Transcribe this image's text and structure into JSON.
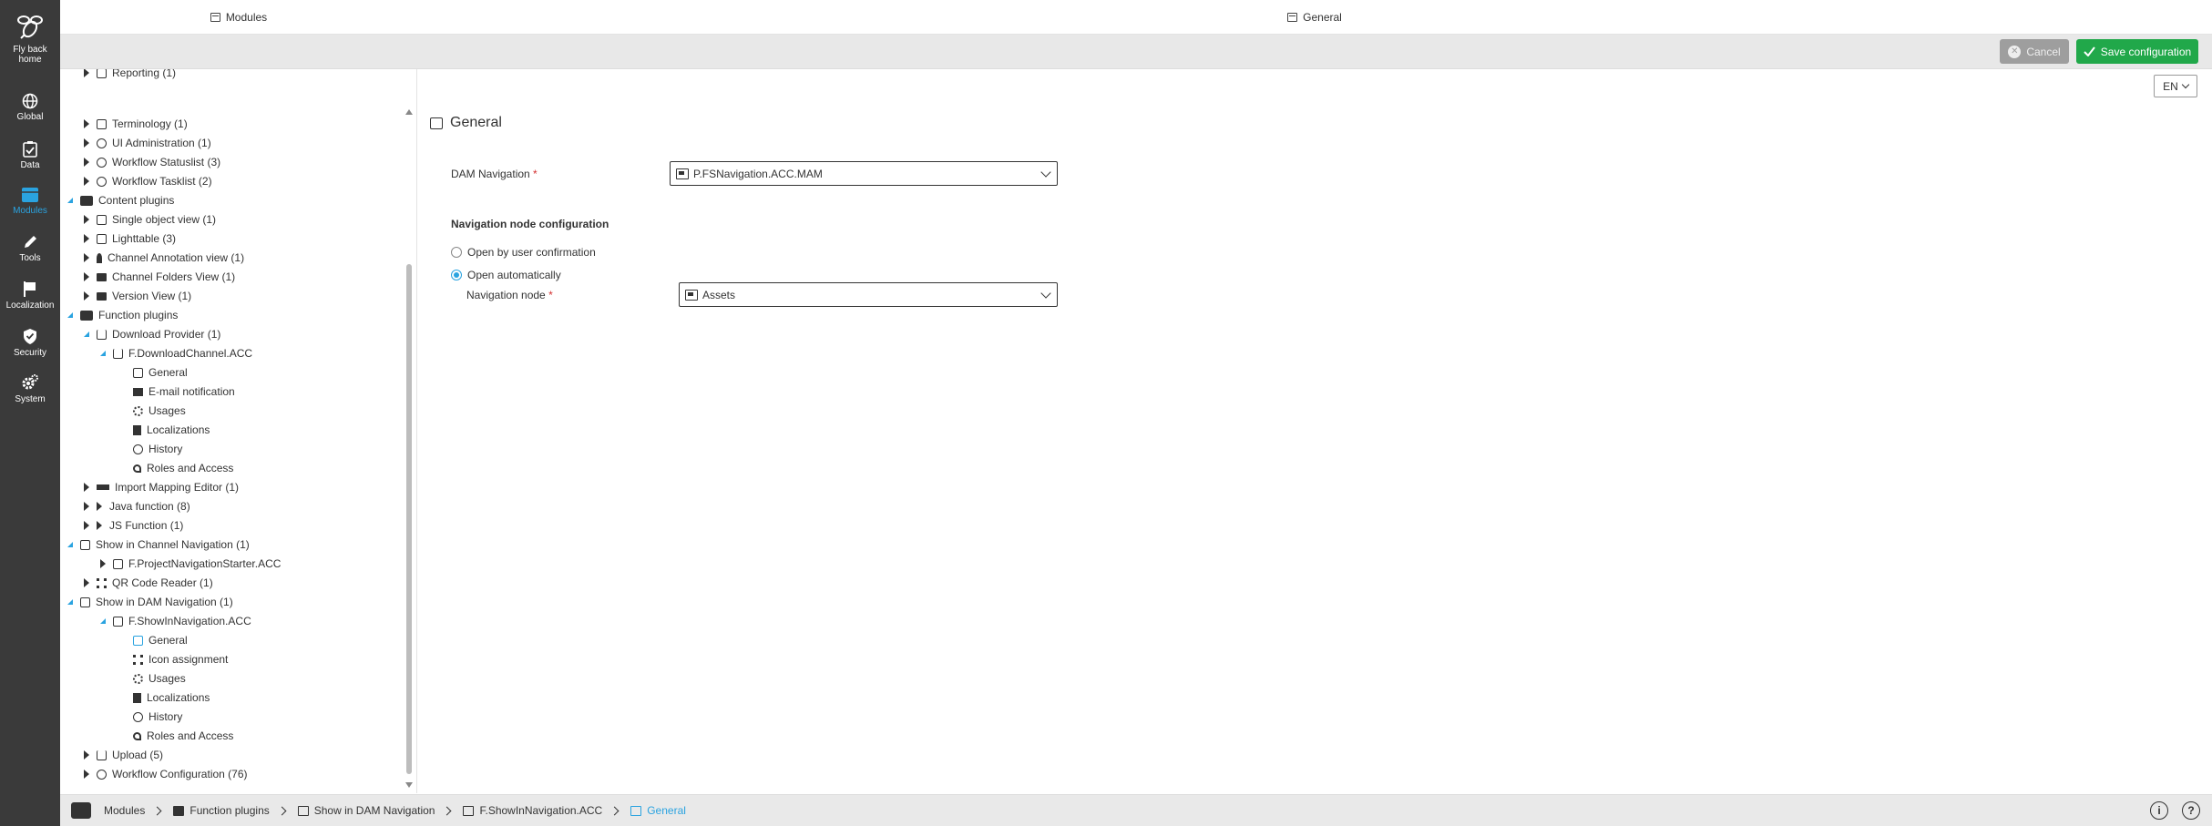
{
  "rail": {
    "items": [
      {
        "label": "Fly back home",
        "icon": "bee-logo-icon"
      },
      {
        "label": "Global",
        "icon": "globe-icon"
      },
      {
        "label": "Data",
        "icon": "clipboard-check-icon"
      },
      {
        "label": "Modules",
        "icon": "modules-icon",
        "active": true
      },
      {
        "label": "Tools",
        "icon": "pencil-icon"
      },
      {
        "label": "Localization",
        "icon": "flag-icon"
      },
      {
        "label": "Security",
        "icon": "shield-icon"
      },
      {
        "label": "System",
        "icon": "gears-icon"
      }
    ],
    "active_color": "#2aa3e0"
  },
  "tree_header": {
    "title": "Modules"
  },
  "main_header": {
    "title": "General"
  },
  "toolbar": {
    "cancel_label": "Cancel",
    "save_label": "Save configuration",
    "save_color": "#21a84a"
  },
  "tree": {
    "rows": [
      {
        "label": "Reporting (1)"
      },
      {
        "label": "Terminology (1)"
      },
      {
        "label": "UI Administration (1)"
      },
      {
        "label": "Workflow Statuslist (3)"
      },
      {
        "label": "Workflow Tasklist (2)"
      },
      {
        "label": "Content plugins"
      },
      {
        "label": "Single object view (1)"
      },
      {
        "label": "Lighttable (3)"
      },
      {
        "label": "Channel Annotation view (1)"
      },
      {
        "label": "Channel Folders View (1)"
      },
      {
        "label": "Version View (1)"
      },
      {
        "label": "Function plugins"
      },
      {
        "label": "Download Provider (1)"
      },
      {
        "label": "F.DownloadChannel.ACC"
      },
      {
        "label": "General"
      },
      {
        "label": "E-mail notification"
      },
      {
        "label": "Usages"
      },
      {
        "label": "Localizations"
      },
      {
        "label": "History"
      },
      {
        "label": "Roles and Access"
      },
      {
        "label": "Import Mapping Editor (1)"
      },
      {
        "label": "Java function (8)"
      },
      {
        "label": "JS Function (1)"
      },
      {
        "label": "Show in Channel Navigation (1)"
      },
      {
        "label": "F.ProjectNavigationStarter.ACC"
      },
      {
        "label": "QR Code Reader (1)"
      },
      {
        "label": "Show in DAM Navigation (1)"
      },
      {
        "label": "F.ShowInNavigation.ACC"
      },
      {
        "label": "General"
      },
      {
        "label": "Icon assignment"
      },
      {
        "label": "Usages"
      },
      {
        "label": "Localizations"
      },
      {
        "label": "History"
      },
      {
        "label": "Roles and Access"
      },
      {
        "label": "Upload (5)"
      },
      {
        "label": "Workflow Configuration (76)"
      }
    ]
  },
  "lang": {
    "value": "EN"
  },
  "main": {
    "section_title": "General",
    "dam_navigation": {
      "label": "DAM Navigation",
      "required_mark": "*",
      "value": "P.FSNavigation.ACC.MAM"
    },
    "nav_config_title": "Navigation node configuration",
    "radio_confirm": "Open by user confirmation",
    "radio_auto": "Open automatically",
    "nav_node": {
      "label": "Navigation node",
      "required_mark": "*",
      "value": "Assets"
    }
  },
  "breadcrumb": {
    "items": [
      "Modules",
      "Function plugins",
      "Show in DAM Navigation",
      "F.ShowInNavigation.ACC",
      "General"
    ]
  },
  "help": {
    "info": "i",
    "question": "?"
  }
}
